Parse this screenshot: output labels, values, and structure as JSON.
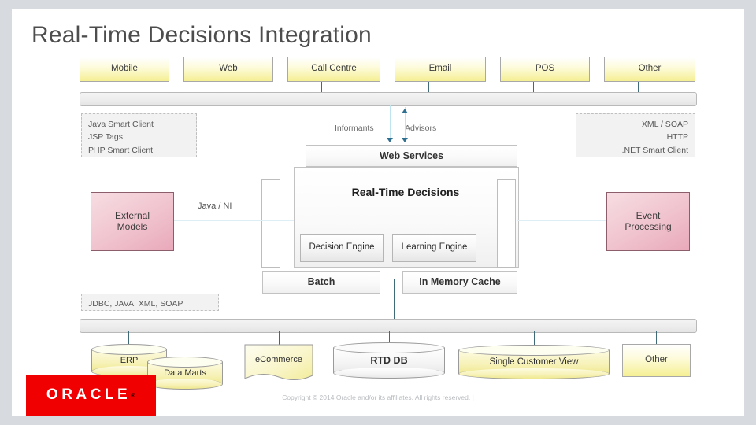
{
  "slide": {
    "title": "Real-Time Decisions Integration"
  },
  "channels": [
    {
      "label": "Mobile"
    },
    {
      "label": "Web"
    },
    {
      "label": "Call Centre"
    },
    {
      "label": "Email"
    },
    {
      "label": "POS"
    },
    {
      "label": "Other"
    }
  ],
  "client_stack_left": "Java Smart Client\nJSP Tags\nPHP Smart Client",
  "client_stack_right": "XML / SOAP\nHTTP\n.NET Smart Client",
  "flow_labels": {
    "informants": "Informants",
    "advisors": "Advisors",
    "java_ni": "Java / NI",
    "data_protocols": "JDBC, JAVA, XML, SOAP"
  },
  "core": {
    "web_services": "Web Services",
    "title": "Real-Time Decisions",
    "decision_engine": "Decision Engine",
    "learning_engine": "Learning Engine",
    "batch": "Batch",
    "in_memory_cache": "In Memory Cache"
  },
  "side_modules": {
    "left": "External\nModels",
    "right": "Event\nProcessing"
  },
  "data_sources": [
    {
      "label": "ERP",
      "shape": "cylinder-yellow"
    },
    {
      "label": "Data Marts",
      "shape": "cylinder-yellow"
    },
    {
      "label": "eCommerce",
      "shape": "document"
    },
    {
      "label": "RTD DB",
      "shape": "cylinder-gray"
    },
    {
      "label": "Single Customer View",
      "shape": "cylinder-yellow"
    },
    {
      "label": "Other",
      "shape": "box-yellow"
    }
  ],
  "footer": {
    "logo": "ORACLE",
    "logo_mark": "®",
    "copyright": "Copyright © 2014 Oracle and/or its affiliates. All rights reserved.  |"
  },
  "colors": {
    "brand_red": "#f00000",
    "channel_yellow": "#f5ef94",
    "module_pink": "#e9a9ba",
    "connector_blue": "#3f6b79"
  }
}
